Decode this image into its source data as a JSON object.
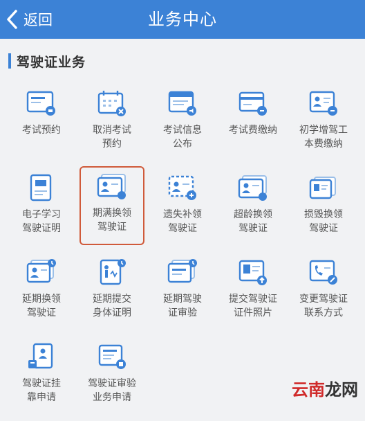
{
  "header": {
    "back_label": "返回",
    "title": "业务中心"
  },
  "section": {
    "title": "驾驶证业务"
  },
  "colors": {
    "accent": "#3c82d6",
    "selected_border": "#d05a3a"
  },
  "items": [
    {
      "label": "考试预约",
      "icon": "exam-booking-icon"
    },
    {
      "label": "取消考试\n预约",
      "icon": "cancel-exam-icon"
    },
    {
      "label": "考试信息\n公布",
      "icon": "exam-info-icon"
    },
    {
      "label": "考试费缴纳",
      "icon": "exam-fee-icon"
    },
    {
      "label": "初学增驾工\n本费缴纳",
      "icon": "fee-payment-icon"
    },
    {
      "label": "电子学习\n驾驶证明",
      "icon": "learning-permit-icon"
    },
    {
      "label": "期满换领\n驾驶证",
      "icon": "license-renewal-icon"
    },
    {
      "label": "遗失补领\n驾驶证",
      "icon": "lost-license-icon"
    },
    {
      "label": "超龄换领\n驾驶证",
      "icon": "overage-renewal-icon"
    },
    {
      "label": "损毁换领\n驾驶证",
      "icon": "damaged-license-icon"
    },
    {
      "label": "延期换领\n驾驶证",
      "icon": "delay-renewal-icon"
    },
    {
      "label": "延期提交\n身体证明",
      "icon": "health-certificate-icon"
    },
    {
      "label": "延期驾驶\n证审验",
      "icon": "delay-review-icon"
    },
    {
      "label": "提交驾驶证\n证件照片",
      "icon": "upload-photo-icon"
    },
    {
      "label": "变更驾驶证\n联系方式",
      "icon": "contact-change-icon"
    },
    {
      "label": "驾驶证挂\n靠申请",
      "icon": "affiliation-icon"
    },
    {
      "label": "驾驶证审验\n业务申请",
      "icon": "review-application-icon"
    }
  ],
  "watermark": {
    "part1": "云南",
    "part2": "龙网"
  }
}
